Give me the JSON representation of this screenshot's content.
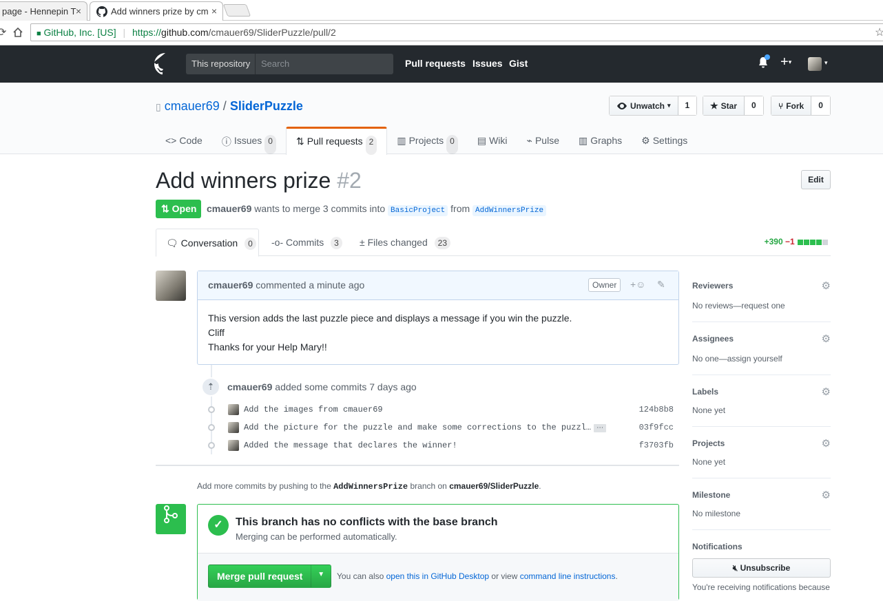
{
  "browser": {
    "tab1_title": "page - Hennepin T",
    "tab2_title": "Add winners prize by cm",
    "close_glyph": "×",
    "secure_label": "GitHub, Inc. [US]",
    "url_scheme": "https://",
    "url_host": "github.com",
    "url_path": "/cmauer69/SliderPuzzle/pull/2"
  },
  "header": {
    "search_scope": "This repository",
    "search_placeholder": "Search",
    "nav": [
      "Pull requests",
      "Issues",
      "Gist"
    ]
  },
  "repo": {
    "owner": "cmauer69",
    "separator": "/",
    "name": "SliderPuzzle",
    "watch_label": "Unwatch",
    "watch_count": "1",
    "star_label": "Star",
    "star_count": "0",
    "fork_label": "Fork",
    "fork_count": "0",
    "tabs": [
      {
        "label": "Code",
        "count": ""
      },
      {
        "label": "Issues",
        "count": "0"
      },
      {
        "label": "Pull requests",
        "count": "2"
      },
      {
        "label": "Projects",
        "count": "0"
      },
      {
        "label": "Wiki",
        "count": ""
      },
      {
        "label": "Pulse",
        "count": ""
      },
      {
        "label": "Graphs",
        "count": ""
      },
      {
        "label": "Settings",
        "count": ""
      }
    ]
  },
  "pr": {
    "title": "Add winners prize",
    "number": "#2",
    "edit_label": "Edit",
    "state": "Open",
    "author": "cmauer69",
    "meta_text": "wants to merge 3 commits into",
    "base_branch": "BasicProject",
    "from_text": "from",
    "head_branch": "AddWinnersPrize",
    "tabs": [
      {
        "label": "Conversation",
        "count": "0"
      },
      {
        "label": "Commits",
        "count": "3"
      },
      {
        "label": "Files changed",
        "count": "23"
      }
    ],
    "additions": "+390",
    "deletions": "−1"
  },
  "comment": {
    "author": "cmauer69",
    "time_text": "commented a minute ago",
    "owner_label": "Owner",
    "lines": [
      "This version adds the last puzzle piece and displays a message if you win the puzzle.",
      "Cliff",
      "Thanks for your Help Mary!!"
    ]
  },
  "commits_event": {
    "author": "cmauer69",
    "text": "added some commits 7 days ago",
    "commits": [
      {
        "message": "Add the images from cmauer69",
        "sha": "124b8b8"
      },
      {
        "message": "Add the picture for the puzzle and make some corrections to the puzzl…",
        "sha": "03f9fcc"
      },
      {
        "message": "Added the message that declares the winner!",
        "sha": "f3703fb"
      }
    ]
  },
  "push_note": {
    "prefix": "Add more commits by pushing to the",
    "branch": "AddWinnersPrize",
    "middle": "branch on",
    "repo": "cmauer69/SliderPuzzle",
    "suffix": "."
  },
  "merge": {
    "title": "This branch has no conflicts with the base branch",
    "subtitle": "Merging can be performed automatically.",
    "button_label": "Merge pull request",
    "alt_prefix": "You can also",
    "alt_link1": "open this in GitHub Desktop",
    "alt_middle": "or view",
    "alt_link2": "command line instructions",
    "alt_suffix": "."
  },
  "sidebar": {
    "sections": [
      {
        "title": "Reviewers",
        "value": "No reviews—request one"
      },
      {
        "title": "Assignees",
        "value": "No one—assign yourself"
      },
      {
        "title": "Labels",
        "value": "None yet"
      },
      {
        "title": "Projects",
        "value": "None yet"
      },
      {
        "title": "Milestone",
        "value": "No milestone"
      }
    ],
    "notifications_title": "Notifications",
    "unsubscribe_label": "Unsubscribe",
    "notifications_note": "You're receiving notifications because"
  },
  "colors": {
    "header_bg": "#24292e",
    "open_green": "#2cbe4e",
    "link_blue": "#0366d6",
    "tab_accent": "#e36209"
  },
  "icons": [
    "github-logo-icon",
    "bell-icon",
    "plus-icon",
    "eye-icon",
    "star-icon",
    "repo-forked-icon",
    "code-icon",
    "issue-icon",
    "git-pull-request-icon",
    "project-icon",
    "book-icon",
    "pulse-icon",
    "graph-icon",
    "gear-icon",
    "comment-discussion-icon",
    "git-commit-icon",
    "diff-icon",
    "emoji-icon",
    "pencil-icon",
    "repo-push-icon",
    "check-icon",
    "git-merge-icon",
    "mute-icon"
  ]
}
